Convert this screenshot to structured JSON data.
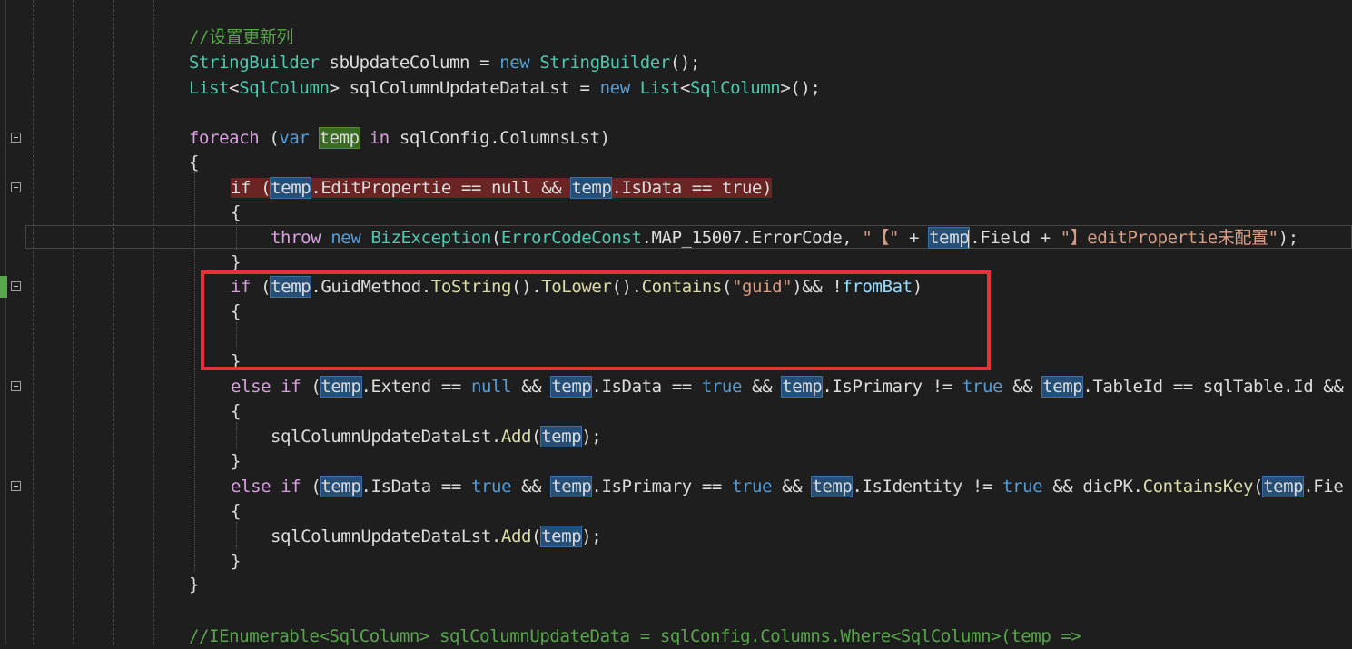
{
  "editor": {
    "language": "C#",
    "colors": {
      "background": "#1e1e1e",
      "comment": "#57a64a",
      "type": "#4ec9b0",
      "keyword": "#569cd6",
      "control": "#d8a0df",
      "method": "#dcdcaa",
      "string": "#d69d85",
      "highlight": "#264f78",
      "error_line": "#6b2424",
      "annotation_box": "#e8323a"
    },
    "lines": {
      "l1": {
        "comment": "//设置更新列"
      },
      "l2": {
        "type": "StringBuilder",
        "name": " sbUpdateColumn = ",
        "kw": "new",
        "type2": " StringBuilder",
        "rest": "();"
      },
      "l3": {
        "type": "List",
        "lt": "<",
        "type_arg": "SqlColumn",
        "gt": ">",
        "name": " sqlColumnUpdateDataLst = ",
        "kw": "new",
        "type2": " List",
        "lt2": "<",
        "type_arg2": "SqlColumn",
        "rest": ">();"
      },
      "l5": {
        "kw": "foreach",
        "p1": " (",
        "var": "var",
        "sp": " ",
        "var_name": "temp",
        "sp2": " ",
        "in": "in",
        "rest": " sqlConfig.ColumnsLst)"
      },
      "l6": {
        "brace": "{"
      },
      "l7": {
        "text_a": "if (",
        "v1": "temp",
        "text_b": ".EditPropertie == null && ",
        "v2": "temp",
        "text_c": ".IsData == true)"
      },
      "l8": {
        "brace": "{"
      },
      "l9": {
        "kw_throw": "throw",
        "kw_new": " new",
        "type": " BizException",
        "p": "(",
        "type2": "ErrorCodeConst",
        "mid": ".MAP_15007.ErrorCode, ",
        "s1": "\"【\"",
        "plus": " + ",
        "v1": "temp",
        "field": ".Field + ",
        "s2": "\"】editPropertie未配置\"",
        "end": ");"
      },
      "l10": {
        "brace": "}"
      },
      "l11": {
        "kw": "if",
        "p": " (",
        "v1": "temp",
        "a": ".GuidMethod.",
        "m1": "ToString",
        "b": "().",
        "m2": "ToLower",
        "c": "().",
        "m3": "Contains",
        "d": "(",
        "s": "\"guid\"",
        "e": ")&& !",
        "f": "fromBat",
        "g": ")"
      },
      "l12": {
        "brace": "{"
      },
      "l14": {
        "brace": "}"
      },
      "l15": {
        "kw_else": "else",
        "kw_if": " if",
        "p": " (",
        "v1": "temp",
        "a": ".Extend == ",
        "k1": "null",
        "b": " && ",
        "v2": "temp",
        "c": ".IsData == ",
        "k2": "true",
        "d": " && ",
        "v3": "temp",
        "e": ".IsPrimary != ",
        "k3": "true",
        "f": " && ",
        "v4": "temp",
        "g": ".TableId == sqlTable.Id &&"
      },
      "l16": {
        "brace": "{"
      },
      "l17": {
        "a": "sqlColumnUpdateDataLst.",
        "m": "Add",
        "p": "(",
        "v": "temp",
        "e": ");"
      },
      "l18": {
        "brace": "}"
      },
      "l19": {
        "kw_else": "else",
        "kw_if": " if",
        "p": " (",
        "v1": "temp",
        "a": ".IsData == ",
        "k1": "true",
        "b": " && ",
        "v2": "temp",
        "c": ".IsPrimary == ",
        "k2": "true",
        "d": " && ",
        "v3": "temp",
        "e": ".IsIdentity != ",
        "k3": "true",
        "f": " && dicPK.",
        "m": "ContainsKey",
        "g": "(",
        "v4": "temp",
        "h": ".Fie"
      },
      "l20": {
        "brace": "{"
      },
      "l21": {
        "a": "sqlColumnUpdateDataLst.",
        "m": "Add",
        "p": "(",
        "v": "temp",
        "e": ");"
      },
      "l22": {
        "brace": "}"
      },
      "l23": {
        "brace": "}"
      },
      "l25": {
        "comment": "//IEnumerable<SqlColumn> sqlColumnUpdateData = sqlConfig.Columns.Where<SqlColumn>(temp =>"
      }
    }
  }
}
